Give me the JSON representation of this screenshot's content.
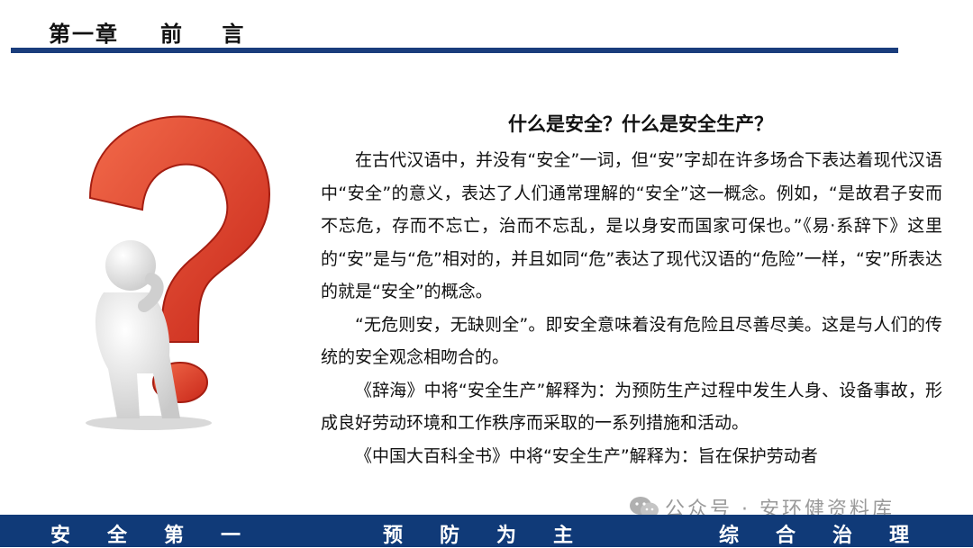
{
  "header": {
    "chapter_label": "第一章",
    "chapter_title": "前 言"
  },
  "content": {
    "heading": "什么是安全？什么是安全生产？",
    "paragraphs": [
      "在古代汉语中，并没有“安全”一词，但“安”字却在许多场合下表达着现代汉语中“安全”的意义，表达了人们通常理解的“安全”这一概念。例如，“是故君子安而不忘危，存而不忘亡，治而不忘乱，是以身安而国家可保也。”《易·系辞下》这里的“安”是与“危”相对的，并且如同“危”表达了现代汉语的“危险”一样，“安”所表达的就是“安全”的概念。",
      "“无危则安，无缺则全”。即安全意味着没有危险且尽善尽美。这是与人们的传统的安全观念相吻合的。",
      "《辞海》中将“安全生产”解释为：为预防生产过程中发生人身、设备事故，形成良好劳动环境和工作秩序而采取的一系列措施和活动。",
      "《中国大百科全书》中将“安全生产”解释为：旨在保护劳动者"
    ]
  },
  "watermark": {
    "icon": "wechat-icon",
    "text": "公众号 · 安环健资料库"
  },
  "footer": {
    "slogans": [
      "安全第一",
      "预防为主",
      "综合治理"
    ]
  },
  "colors": {
    "primary": "#103a78",
    "accent_red": "#e5402a"
  }
}
